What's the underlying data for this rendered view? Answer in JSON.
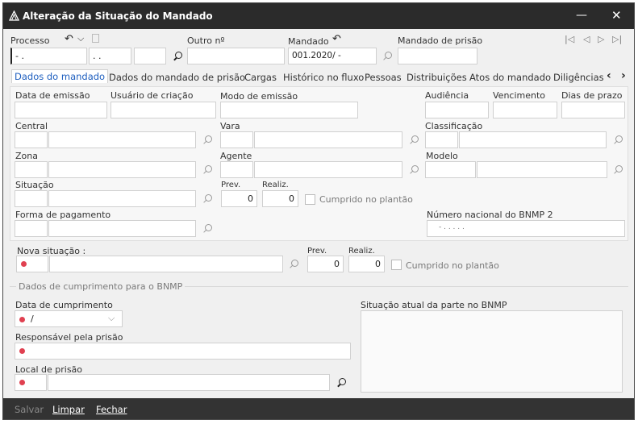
{
  "window": {
    "title": "Alteração da Situação do Mandado",
    "minimize_glyph": "—",
    "close_glyph": "✕"
  },
  "header": {
    "processo_label": "Processo",
    "processo_values": [
      "- .",
      ". .",
      ""
    ],
    "outro_label": "Outro nº",
    "outro_value": "",
    "mandado_label": "Mandado",
    "mandado_value": "001.2020/      -",
    "prisao_label": "Mandado de prisão",
    "prisao_value": "",
    "nav_icons": [
      "first-record-icon",
      "previous-record-icon",
      "next-record-icon",
      "last-record-icon"
    ]
  },
  "tabs": [
    {
      "label": "Dados do mandado",
      "active": true
    },
    {
      "label": "Dados do mandado de prisão"
    },
    {
      "label": "Cargas"
    },
    {
      "label": "Histórico no fluxo"
    },
    {
      "label": "Pessoas"
    },
    {
      "label": "Distribuições"
    },
    {
      "label": "Atos do mandado"
    },
    {
      "label": "Diligências"
    }
  ],
  "tab_arrows": {
    "left": "‹",
    "right": "›"
  },
  "form": {
    "data_emissao": "Data de emissão",
    "usuario_criacao": "Usuário de criação",
    "modo_emissao": "Modo de emissão",
    "audiencia": "Audiência",
    "vencimento": "Vencimento",
    "dias_prazo": "Dias de prazo",
    "central": "Central",
    "vara": "Vara",
    "classificacao": "Classificação",
    "zona": "Zona",
    "agente": "Agente",
    "modelo": "Modelo",
    "situacao": "Situação",
    "prev": "Prev.",
    "prev_value": "0",
    "realiz": "Realiz.",
    "realiz_value": "0",
    "cumprido": "Cumprido no plantão",
    "forma_pagamento": "Forma de pagamento",
    "bnmp_numero": "Número nacional do BNMP 2",
    "bnmp_value": "-  .  .  .  .  ."
  },
  "nova": {
    "label": "Nova situação :",
    "prev": "Prev.",
    "prev_value": "0",
    "realiz": "Realiz.",
    "realiz_value": "0",
    "cumprido": "Cumprido no plantão"
  },
  "bnmp": {
    "group_label": "Dados de cumprimento para o BNMP",
    "data_cumprimento": "Data de cumprimento",
    "data_value": "/",
    "responsavel": "Responsável pela prisão",
    "local": "Local de prisão",
    "situacao_atual": "Situação atual da parte no BNMP"
  },
  "footer": {
    "salvar": "Salvar",
    "limpar": "Limpar",
    "fechar": "Fechar"
  }
}
